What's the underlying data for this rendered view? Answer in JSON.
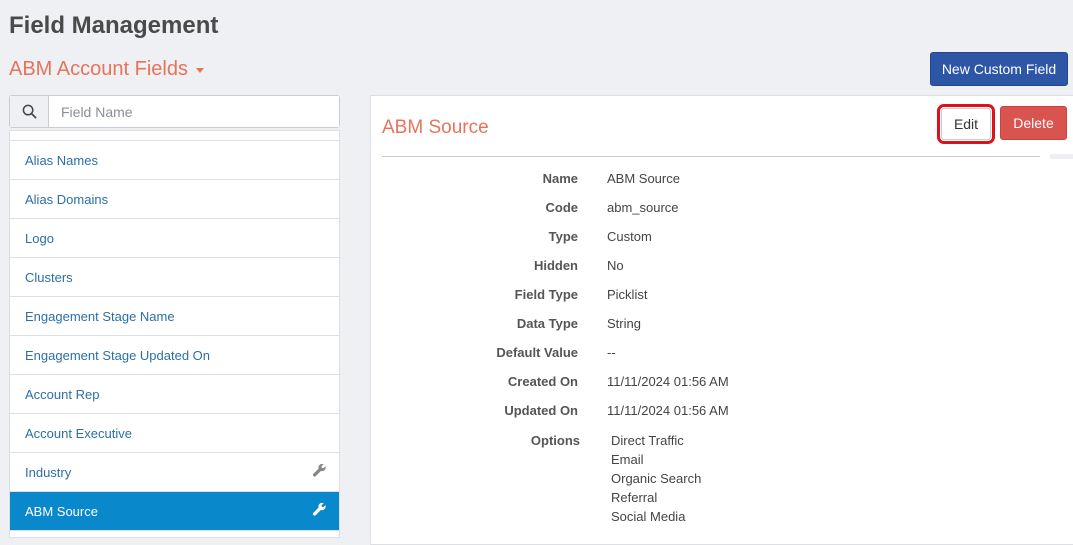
{
  "page": {
    "title": "Field Management",
    "section_label": "ABM Account Fields",
    "new_field_label": "New Custom Field"
  },
  "search": {
    "placeholder": "Field Name",
    "icon": "search-icon"
  },
  "field_list": {
    "items": [
      {
        "label": "Alias Names",
        "has_wrench": false,
        "active": false
      },
      {
        "label": "Alias Domains",
        "has_wrench": false,
        "active": false
      },
      {
        "label": "Logo",
        "has_wrench": false,
        "active": false
      },
      {
        "label": "Clusters",
        "has_wrench": false,
        "active": false
      },
      {
        "label": "Engagement Stage Name",
        "has_wrench": false,
        "active": false
      },
      {
        "label": "Engagement Stage Updated On",
        "has_wrench": false,
        "active": false
      },
      {
        "label": "Account Rep",
        "has_wrench": false,
        "active": false
      },
      {
        "label": "Account Executive",
        "has_wrench": false,
        "active": false
      },
      {
        "label": "Industry",
        "has_wrench": true,
        "active": false
      },
      {
        "label": "ABM Source",
        "has_wrench": true,
        "active": true
      }
    ]
  },
  "detail": {
    "title": "ABM Source",
    "edit_label": "Edit",
    "delete_label": "Delete",
    "properties": [
      {
        "key": "Name",
        "value": "ABM Source"
      },
      {
        "key": "Code",
        "value": "abm_source"
      },
      {
        "key": "Type",
        "value": "Custom"
      },
      {
        "key": "Hidden",
        "value": "No"
      },
      {
        "key": "Field Type",
        "value": "Picklist"
      },
      {
        "key": "Data Type",
        "value": "String"
      },
      {
        "key": "Default Value",
        "value": "--"
      },
      {
        "key": "Created On",
        "value": "11/11/2024 01:56 AM"
      },
      {
        "key": "Updated On",
        "value": "11/11/2024 01:56 AM"
      }
    ],
    "options_label": "Options",
    "options": [
      "Direct Traffic",
      "Email",
      "Organic Search",
      "Referral",
      "Social Media"
    ]
  },
  "colors": {
    "accent_orange": "#e8735a",
    "primary_blue": "#2d56a6",
    "active_blue": "#0a88cc",
    "danger_red": "#d9534f",
    "highlight_red": "#e0101a"
  }
}
